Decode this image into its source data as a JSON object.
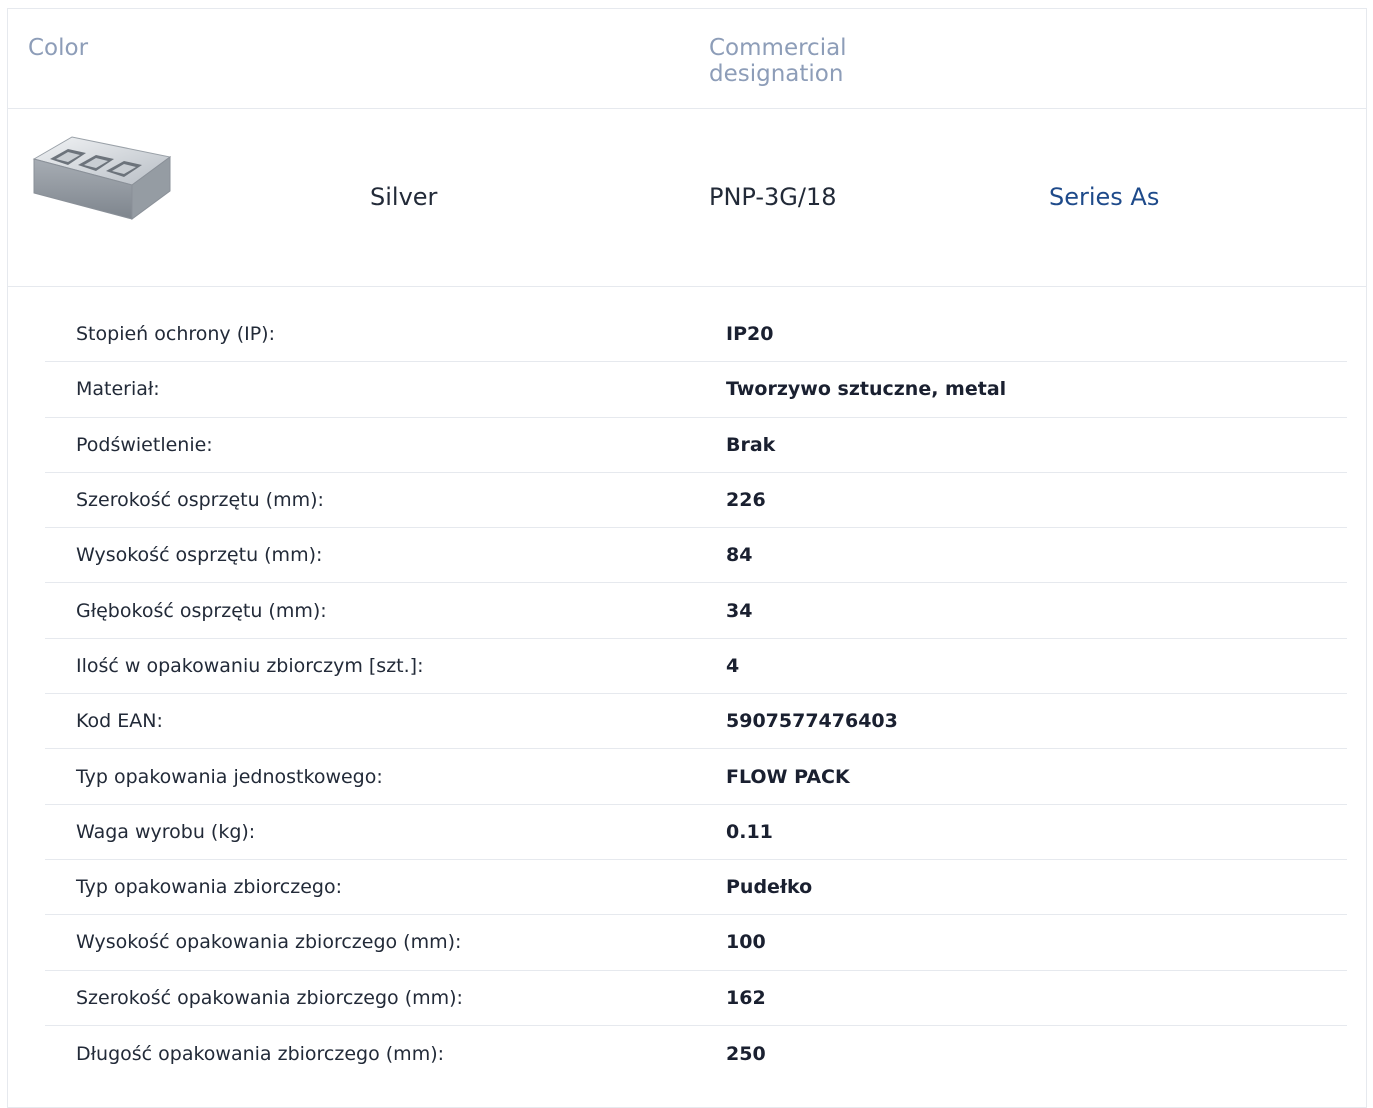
{
  "header": {
    "color_label": "Color",
    "designation_label": "Commercial designation"
  },
  "product": {
    "image_icon": "metal-box-icon",
    "color": "Silver",
    "code": "PNP-3G/18",
    "series_link": "Series As",
    "series_color": "#1e4a8a"
  },
  "specs": [
    {
      "label": "Stopień ochrony (IP):",
      "value": "IP20"
    },
    {
      "label": "Materiał:",
      "value": "Tworzywo sztuczne, metal"
    },
    {
      "label": "Podświetlenie:",
      "value": "Brak"
    },
    {
      "label": "Szerokość osprzętu (mm):",
      "value": "226"
    },
    {
      "label": "Wysokość osprzętu (mm):",
      "value": "84"
    },
    {
      "label": "Głębokość osprzętu (mm):",
      "value": "34"
    },
    {
      "label": "Ilość w opakowaniu zbiorczym [szt.]:",
      "value": "4"
    },
    {
      "label": "Kod EAN:",
      "value": "5907577476403"
    },
    {
      "label": "Typ opakowania jednostkowego:",
      "value": "FLOW PACK"
    },
    {
      "label": "Waga wyrobu (kg):",
      "value": "0.11"
    },
    {
      "label": "Typ opakowania zbiorczego:",
      "value": "Pudełko"
    },
    {
      "label": "Wysokość opakowania zbiorczego (mm):",
      "value": "100"
    },
    {
      "label": "Szerokość opakowania zbiorczego (mm):",
      "value": "162"
    },
    {
      "label": "Długość opakowania zbiorczego (mm):",
      "value": "250"
    }
  ]
}
